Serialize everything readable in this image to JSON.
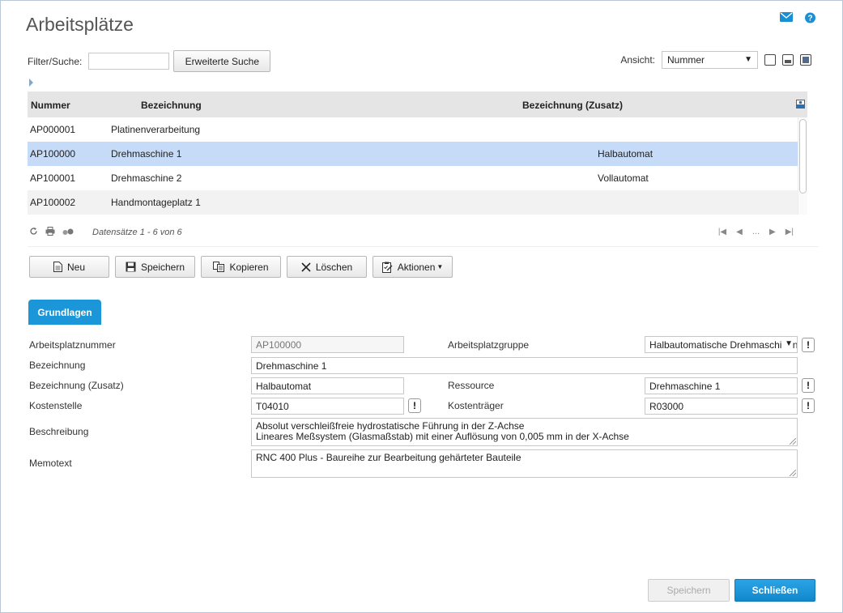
{
  "page": {
    "title": "Arbeitsplätze"
  },
  "filter": {
    "label": "Filter/Suche:",
    "value": "",
    "advanced_button": "Erweiterte Suche"
  },
  "view": {
    "label": "Ansicht:",
    "selected": "Nummer"
  },
  "grid": {
    "columns": [
      "Nummer",
      "Bezeichnung",
      "Bezeichnung (Zusatz)"
    ],
    "rows": [
      {
        "nummer": "AP000001",
        "bezeichnung": "Platinenverarbeitung",
        "zusatz": ""
      },
      {
        "nummer": "AP100000",
        "bezeichnung": "Drehmaschine 1",
        "zusatz": "Halbautomat"
      },
      {
        "nummer": "AP100001",
        "bezeichnung": "Drehmaschine 2",
        "zusatz": "Vollautomat"
      },
      {
        "nummer": "AP100002",
        "bezeichnung": "Handmontageplatz 1",
        "zusatz": ""
      }
    ],
    "record_count": "Datensätze 1 - 6 von 6",
    "pager_dots": "..."
  },
  "toolbar": {
    "new": "Neu",
    "save": "Speichern",
    "copy": "Kopieren",
    "delete": "Löschen",
    "actions": "Aktionen"
  },
  "tab": {
    "label": "Grundlagen"
  },
  "form": {
    "nummer_label": "Arbeitsplatznummer",
    "nummer_value": "AP100000",
    "gruppe_label": "Arbeitsplatzgruppe",
    "gruppe_value": "Halbautomatische Drehmaschinen",
    "bez_label": "Bezeichnung",
    "bez_value": "Drehmaschine 1",
    "zusatz_label": "Bezeichnung (Zusatz)",
    "zusatz_value": "Halbautomat",
    "ressource_label": "Ressource",
    "ressource_value": "Drehmaschine 1",
    "kostenstelle_label": "Kostenstelle",
    "kostenstelle_value": "T04010",
    "kostentraeger_label": "Kostenträger",
    "kostentraeger_value": "R03000",
    "beschreibung_label": "Beschreibung",
    "beschreibung_line1": "Absolut verschleißfreie hydrostatische Führung in der Z-Achse",
    "beschreibung_line2": "Lineares Meßsystem (Glasmaßstab) mit einer Auflösung von 0,005 mm in der X-Achse",
    "memo_label": "Memotext",
    "memo_value": "RNC 400 Plus - Baureihe zur Bearbeitung gehärteter Bauteile",
    "excl": "!"
  },
  "footer": {
    "save": "Speichern",
    "close": "Schließen"
  },
  "colors": {
    "accent": "#1b97d9",
    "selected_row": "#c6dbf7",
    "header_bg": "#e5e5e5"
  }
}
